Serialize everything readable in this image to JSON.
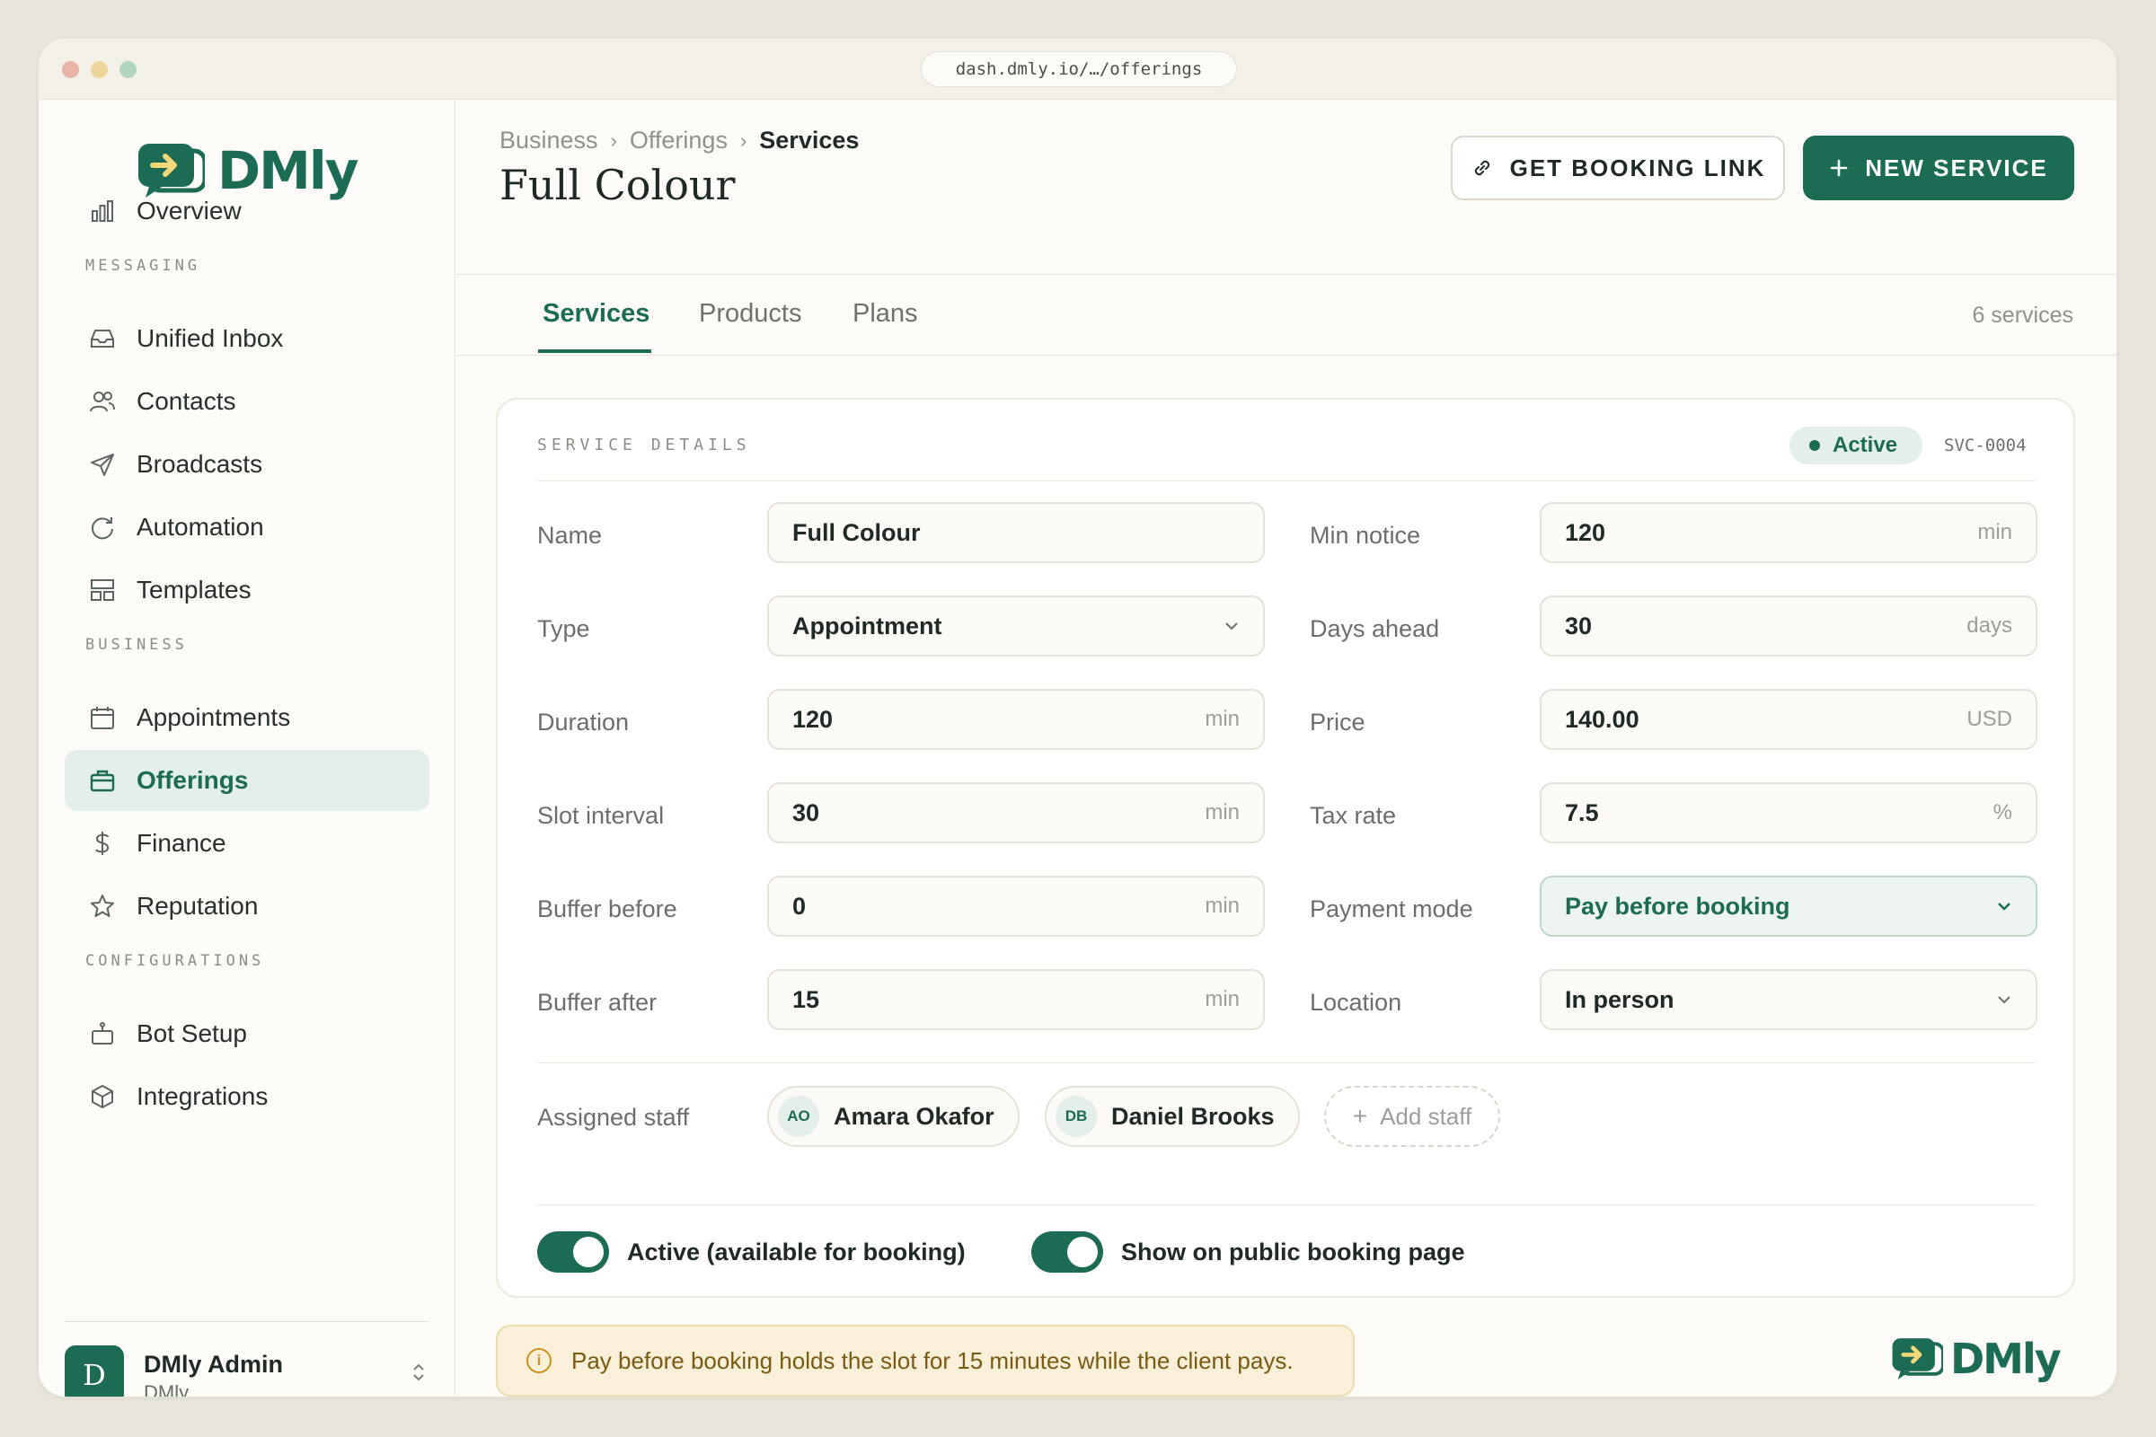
{
  "browser": {
    "url": "dash.dmly.io/…/offerings"
  },
  "brand": {
    "name": "DMly",
    "color": "#1c6b54"
  },
  "sidebar": {
    "overview": "Overview",
    "sections": {
      "messaging": "MESSAGING",
      "business": "BUSINESS",
      "configurations": "CONFIGURATIONS"
    },
    "items": [
      {
        "label": "Unified Inbox",
        "icon": "inbox-icon"
      },
      {
        "label": "Contacts",
        "icon": "contacts-icon"
      },
      {
        "label": "Broadcasts",
        "icon": "send-icon"
      },
      {
        "label": "Automation",
        "icon": "refresh-icon"
      },
      {
        "label": "Templates",
        "icon": "templates-icon"
      },
      {
        "label": "Appointments",
        "icon": "calendar-icon"
      },
      {
        "label": "Offerings",
        "icon": "briefcase-icon",
        "active": true
      },
      {
        "label": "Finance",
        "icon": "dollar-icon"
      },
      {
        "label": "Reputation",
        "icon": "star-icon"
      },
      {
        "label": "Bot Setup",
        "icon": "bot-icon"
      },
      {
        "label": "Integrations",
        "icon": "cube-icon"
      }
    ],
    "user": {
      "initial": "D",
      "name": "DMly Admin",
      "org": "DMly"
    }
  },
  "header": {
    "breadcrumb": [
      "Business",
      "Offerings",
      "Services"
    ],
    "title": "Full Colour",
    "get_link": "GET BOOKING LINK",
    "new_service": "NEW SERVICE"
  },
  "tabs": {
    "items": [
      "Services",
      "Products",
      "Plans"
    ],
    "active": "Services",
    "count": "6 services"
  },
  "service": {
    "section_label": "SERVICE DETAILS",
    "status": "Active",
    "id": "SVC-0004",
    "left": [
      {
        "label": "Name",
        "value": "Full Colour",
        "unit": ""
      },
      {
        "label": "Type",
        "value": "Appointment",
        "select": true
      },
      {
        "label": "Duration",
        "value": "120",
        "unit": "min"
      },
      {
        "label": "Slot interval",
        "value": "30",
        "unit": "min"
      },
      {
        "label": "Buffer before",
        "value": "0",
        "unit": "min"
      },
      {
        "label": "Buffer after",
        "value": "15",
        "unit": "min"
      }
    ],
    "right": [
      {
        "label": "Min notice",
        "value": "120",
        "unit": "min"
      },
      {
        "label": "Days ahead",
        "value": "30",
        "unit": "days"
      },
      {
        "label": "Price",
        "value": "140.00",
        "unit": "USD"
      },
      {
        "label": "Tax rate",
        "value": "7.5",
        "unit": "%"
      },
      {
        "label": "Payment mode",
        "value": "Pay before booking",
        "select": true,
        "highlight": true
      },
      {
        "label": "Location",
        "value": "In person",
        "select": true
      }
    ],
    "staff_label": "Assigned staff",
    "staff": [
      {
        "initials": "AO",
        "name": "Amara Okafor"
      },
      {
        "initials": "DB",
        "name": "Daniel Brooks"
      }
    ],
    "add_staff": "Add staff",
    "toggles": [
      {
        "label": "Active (available for booking)",
        "on": true
      },
      {
        "label": "Show on public booking page",
        "on": true
      }
    ]
  },
  "notice": "Pay before booking holds the slot for 15 minutes while the client pays."
}
